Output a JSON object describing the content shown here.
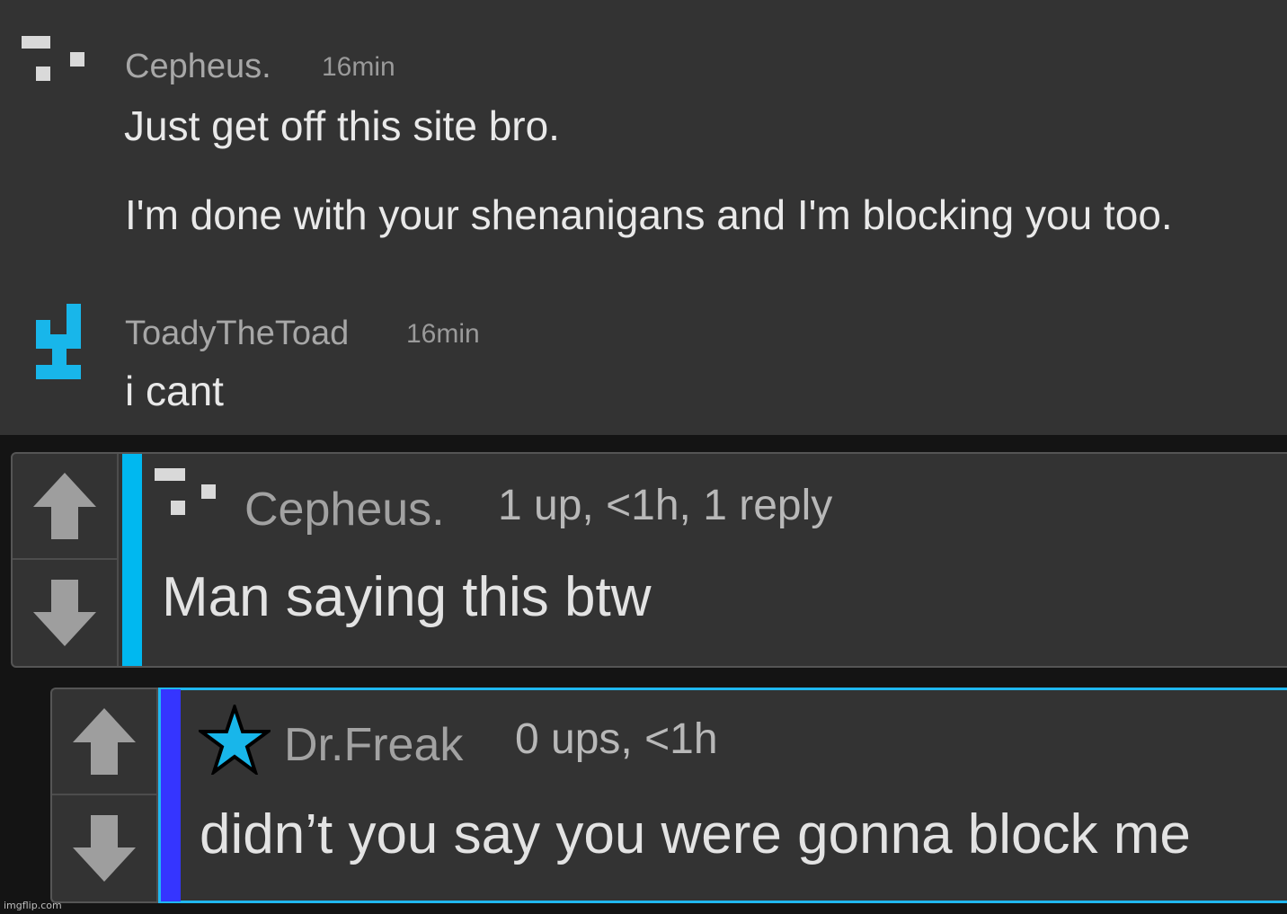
{
  "top_comments": [
    {
      "username": "Cepheus.",
      "time": "16min",
      "lines": [
        "Just get off this site bro.",
        "I'm done with your shenanigans and I'm blocking you too."
      ],
      "avatar": "pixel-avatar-icon"
    },
    {
      "username": "ToadyTheToad",
      "time": "16min",
      "lines": [
        "i cant"
      ],
      "avatar": "pixel-avatar-icon"
    }
  ],
  "thread": [
    {
      "username": "Cepheus.",
      "meta": "1 up, <1h, 1 reply",
      "message": "Man saying this btw",
      "accent_color": "#00b8f0",
      "avatar": "pixel-avatar-icon"
    },
    {
      "username": "Dr.Freak",
      "meta": "0 ups, <1h",
      "message": "didn’t you say you were gonna block me",
      "accent_color": "#3535ff",
      "border_color": "#20b8f0",
      "avatar": "star-icon"
    }
  ],
  "icons": {
    "upvote": "arrow-up-icon",
    "downvote": "arrow-down-icon"
  },
  "watermark": "imgflip.com"
}
